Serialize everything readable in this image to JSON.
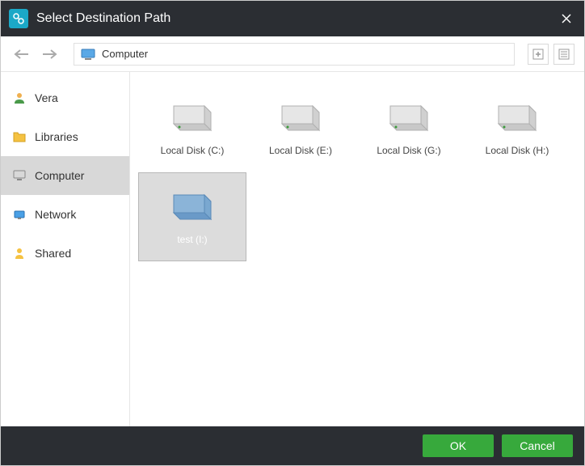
{
  "titlebar": {
    "title": "Select Destination Path"
  },
  "breadcrumb": {
    "path": "Computer"
  },
  "sidebar": {
    "items": [
      {
        "label": "Vera"
      },
      {
        "label": "Libraries"
      },
      {
        "label": "Computer"
      },
      {
        "label": "Network"
      },
      {
        "label": "Shared"
      }
    ],
    "selected_index": 2
  },
  "drives": [
    {
      "label": "Local Disk (C:)",
      "selected": false
    },
    {
      "label": "Local Disk (E:)",
      "selected": false
    },
    {
      "label": "Local Disk (G:)",
      "selected": false
    },
    {
      "label": "Local Disk (H:)",
      "selected": false
    },
    {
      "label": "test (I:)",
      "selected": true
    }
  ],
  "footer": {
    "ok": "OK",
    "cancel": "Cancel"
  }
}
